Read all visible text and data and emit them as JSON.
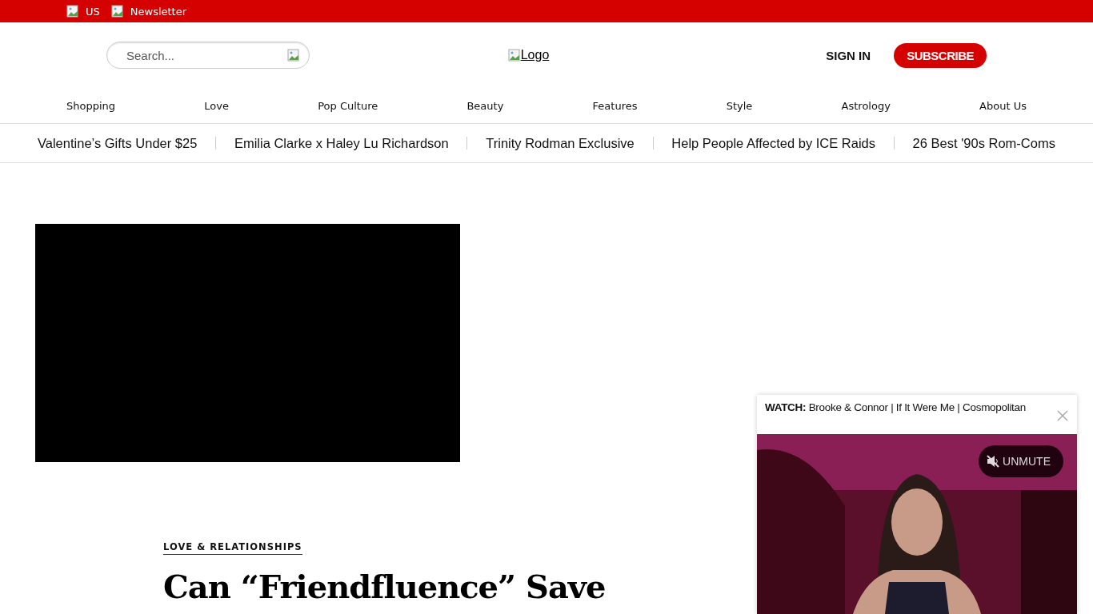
{
  "top_bar": {
    "links": [
      "US",
      "Newsletter"
    ]
  },
  "header": {
    "search": {
      "placeholder": "Search..."
    },
    "logo_alt": "Logo",
    "sign_in": "SIGN IN",
    "subscribe": "SUBSCRIBE"
  },
  "nav": [
    "Shopping",
    "Love",
    "Pop Culture",
    "Beauty",
    "Features",
    "Style",
    "Astrology",
    "About Us"
  ],
  "trending": [
    "Valentine’s Gifts Under $25",
    "Emilia Clarke x Haley Lu Richardson",
    "Trinity Rodman Exclusive",
    "Help People Affected by ICE Raids",
    "26 Best '90s Rom-Coms"
  ],
  "article": {
    "category": "LOVE & RELATIONSHIPS",
    "title": "Can “Friendfluence” Save"
  },
  "video_popup": {
    "title": "**WATCH:** Brooke & Connor | If It Were Me | Cosmopolitan",
    "unmute": "UNMUTE",
    "muted": true
  }
}
